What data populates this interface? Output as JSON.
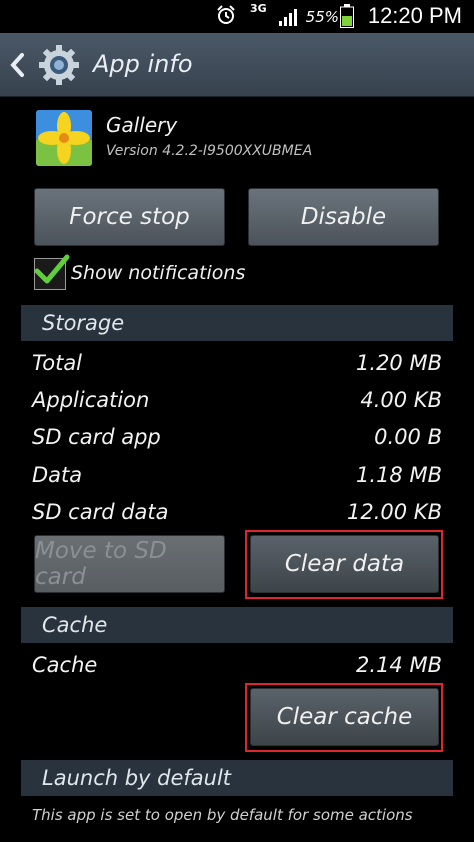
{
  "status_bar": {
    "network": "3G",
    "battery_percent": "55%",
    "time": "12:20 PM"
  },
  "header": {
    "title": "App info",
    "icons": [
      "back-arrow-icon",
      "gear-icon"
    ]
  },
  "app": {
    "name": "Gallery",
    "version": "Version 4.2.2-I9500XXUBMEA"
  },
  "actions": {
    "force_stop": "Force stop",
    "disable": "Disable"
  },
  "notifications": {
    "label": "Show notifications",
    "checked": true
  },
  "storage": {
    "title": "Storage",
    "rows": [
      {
        "label": "Total",
        "value": "1.20 MB"
      },
      {
        "label": "Application",
        "value": "4.00 KB"
      },
      {
        "label": "SD card app",
        "value": "0.00 B"
      },
      {
        "label": "Data",
        "value": "1.18 MB"
      },
      {
        "label": "SD card data",
        "value": "12.00 KB"
      }
    ],
    "move_button": "Move to SD card",
    "clear_data_button": "Clear data"
  },
  "cache": {
    "title": "Cache",
    "label": "Cache",
    "value": "2.14 MB",
    "clear_cache_button": "Clear cache"
  },
  "launch": {
    "title": "Launch by default",
    "note": "This app is set to open by default for some actions"
  },
  "colors": {
    "highlight": "#e0262d",
    "section_bg": "#29333d",
    "check_green": "#5fcf3a"
  }
}
